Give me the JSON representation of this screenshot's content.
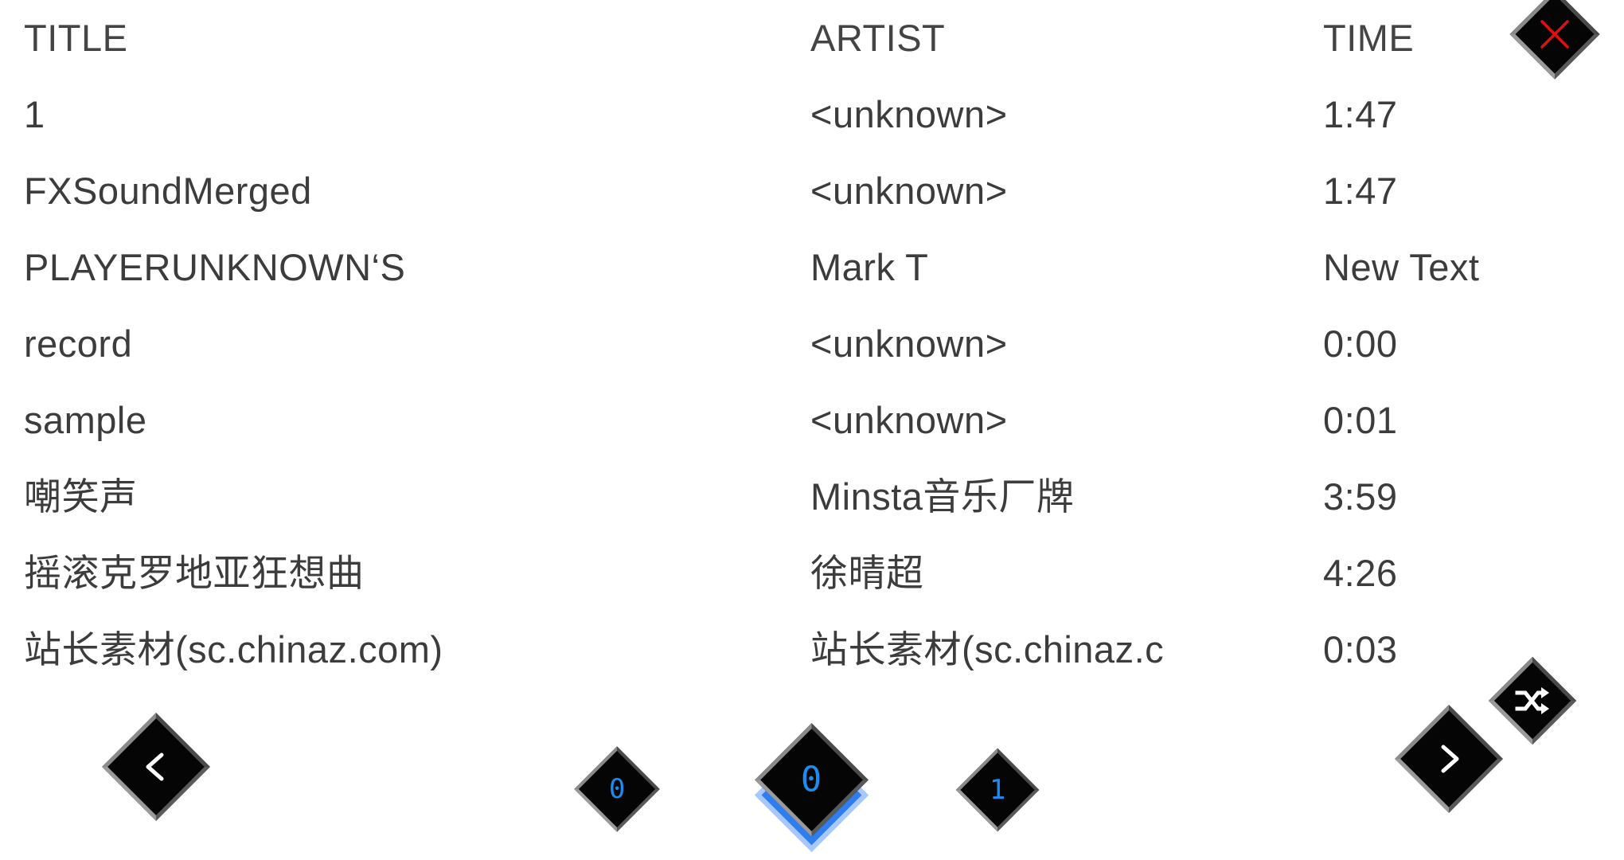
{
  "table": {
    "columns": [
      "TITLE",
      "ARTIST",
      "TIME"
    ],
    "rows": [
      {
        "title": "1",
        "artist": "<unknown>",
        "time": "1:47"
      },
      {
        "title": "FXSoundMerged",
        "artist": "<unknown>",
        "time": "1:47"
      },
      {
        "title": "PLAYERUNKNOWN‘S",
        "artist": "Mark T",
        "time": "New Text"
      },
      {
        "title": "record",
        "artist": "<unknown>",
        "time": "0:00"
      },
      {
        "title": "sample",
        "artist": "<unknown>",
        "time": "0:01"
      },
      {
        "title": "嘲笑声",
        "artist": "Minsta音乐厂牌",
        "time": "3:59"
      },
      {
        "title": "摇滚克罗地亚狂想曲",
        "artist": "徐晴超",
        "time": "4:26"
      },
      {
        "title": "站长素材(sc.chinaz.com)",
        "artist": "站长素材(sc.chinaz.c",
        "time": "0:03"
      }
    ]
  },
  "controls": {
    "close_label": "✕",
    "prev_label": "<",
    "next_label": ">",
    "shuffle_label": "shuffle",
    "pages": [
      {
        "label": "0",
        "selected": false
      },
      {
        "label": "0",
        "selected": true
      },
      {
        "label": "1",
        "selected": false
      }
    ]
  },
  "colors": {
    "text": "#3c3c3c",
    "background": "#ffffff",
    "button_face": "#050505",
    "button_edge": "#8a8a8a",
    "accent_blue": "#1b8cf0",
    "selected_glow": "#2f7ef0",
    "close_red": "#e01010"
  }
}
